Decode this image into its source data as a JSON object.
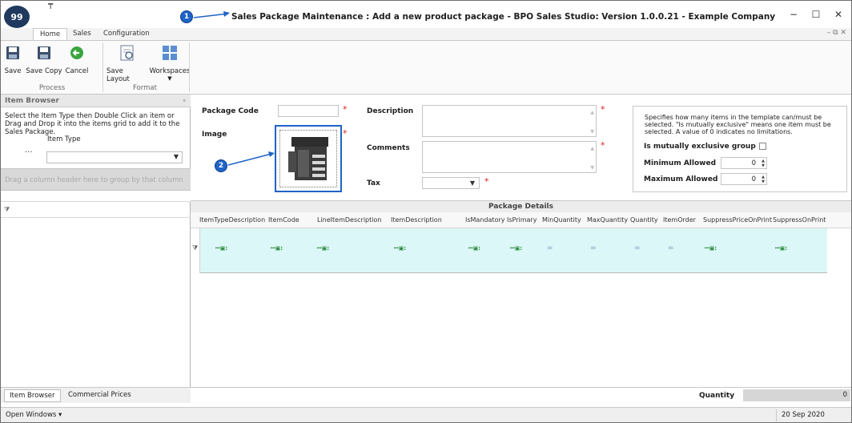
{
  "window": {
    "app_logo_text": "99",
    "qat_glyph": "₸",
    "title": "Sales Package Maintenance : Add a new product package - BPO Sales Studio: Version 1.0.0.21 - Example Company",
    "controls": {
      "minimize": "−",
      "maximize": "☐",
      "close": "✕"
    }
  },
  "callouts": {
    "one": "1",
    "two": "2"
  },
  "ribbon": {
    "tabs": [
      {
        "label": "Home"
      },
      {
        "label": "Sales"
      },
      {
        "label": "Configuration"
      }
    ],
    "right_controls": "– ⧉ ✕",
    "buttons": [
      {
        "label": "Save"
      },
      {
        "label": "Save Copy"
      },
      {
        "label": "Cancel"
      },
      {
        "label": "Save Layout"
      },
      {
        "label": "Workspaces"
      }
    ],
    "groups": [
      {
        "label": "Process"
      },
      {
        "label": "Format"
      }
    ]
  },
  "item_browser": {
    "title": "Item Browser",
    "pin": "ₓ",
    "instructions": "Select the Item Type then Double Click an item or Drag and Drop it into the items grid to add it to the Sales Package.",
    "item_type_label": "Item Type",
    "ellipsis": "...",
    "item_type_value": "",
    "group_panel_text": "Drag a column header here to group by that column"
  },
  "bottom_tabs": [
    {
      "label": "Item Browser"
    },
    {
      "label": "Commercial Prices"
    }
  ],
  "status_bar": {
    "open_windows": "Open Windows ▾",
    "date": "20 Sep 2020"
  },
  "form": {
    "package_code_label": "Package Code",
    "package_code_value": "",
    "image_label": "Image",
    "description_label": "Description",
    "description_value": "",
    "comments_label": "Comments",
    "comments_value": "",
    "tax_label": "Tax",
    "tax_value": "",
    "required_marker": "*"
  },
  "selection_rules": {
    "text": "Specifies how many items in the template can/must be selected. \"Is mutually exclusive\" means one item must be selected. A value of 0 indicates no limitations.",
    "mutually_exclusive_label": "Is mutually exclusive group",
    "mutually_exclusive_checked": false,
    "minimum_label": "Minimum Allowed",
    "minimum_value": "0",
    "maximum_label": "Maximum Allowed",
    "maximum_value": "0"
  },
  "package_details": {
    "title": "Package Details",
    "columns": [
      "ItemTypeDescription",
      "ItemCode",
      "LineItemDescription",
      "ItemDescription",
      "IsMandatory",
      "IsPrimary",
      "MinQuantity",
      "MaxQuantity",
      "Quantity",
      "ItemOrder",
      "SuppressPriceOnPrint",
      "SuppressOnPrint"
    ],
    "new_row_cells": {
      "text_cell": "ꟷ▣꞉",
      "numeric_cell": "="
    }
  },
  "quantity_footer": {
    "label": "Quantity",
    "value": "0"
  },
  "colors": {
    "accent_blue": "#1f63c6",
    "new_row_background": "#dcf7f7",
    "required_red": "#e02020"
  }
}
